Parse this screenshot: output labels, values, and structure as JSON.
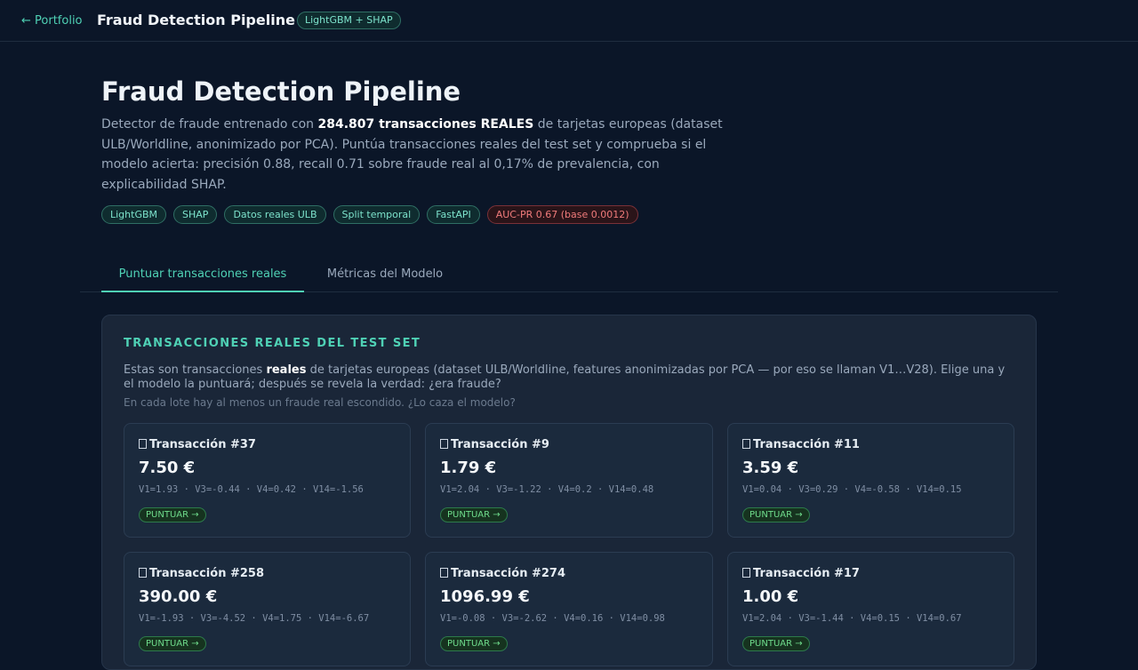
{
  "topbar": {
    "back_label": "← Portfolio",
    "title": "Fraud Detection Pipeline",
    "badge": "LightGBM + SHAP"
  },
  "hero": {
    "title": "Fraud Detection Pipeline",
    "desc_pre": "Detector de fraude entrenado con ",
    "desc_bold": "284.807 transacciones REALES",
    "desc_post": " de tarjetas europeas (dataset ULB/Worldline, anonimizado por PCA). Puntúa transacciones reales del test set y comprueba si el modelo acierta: precisión 0.88, recall 0.71 sobre fraude real al 0,17% de prevalencia, con explicabilidad SHAP."
  },
  "tags": [
    "LightGBM",
    "SHAP",
    "Datos reales ULB",
    "Split temporal",
    "FastAPI",
    "AUC-PR 0.67 (base 0.0012)"
  ],
  "tabs": [
    {
      "label": "Puntuar transacciones reales",
      "active": true
    },
    {
      "label": "Métricas del Modelo",
      "active": false
    }
  ],
  "panel": {
    "section_title": "TRANSACCIONES REALES DEL TEST SET",
    "intro_pre": "Estas son transacciones ",
    "intro_bold": "reales",
    "intro_post": " de tarjetas europeas (dataset ULB/Worldline, features anonimizadas por PCA — por eso se llaman V1…V28). Elige una y el modelo la puntuará; después se revela la verdad: ¿era fraude?",
    "hint": "En cada lote hay al menos un fraude real escondido. ¿Lo caza el modelo?"
  },
  "cards": [
    {
      "title": "Transacción #37",
      "amount": "7.50 €",
      "features": "V1=1.93 · V3=-0.44 · V4=0.42 · V14=-1.56",
      "button": "PUNTUAR →"
    },
    {
      "title": "Transacción #9",
      "amount": "1.79 €",
      "features": "V1=2.04 · V3=-1.22 · V4=0.2 · V14=0.48",
      "button": "PUNTUAR →"
    },
    {
      "title": "Transacción #11",
      "amount": "3.59 €",
      "features": "V1=0.04 · V3=0.29 · V4=-0.58 · V14=0.15",
      "button": "PUNTUAR →"
    },
    {
      "title": "Transacción #258",
      "amount": "390.00 €",
      "features": "V1=-1.93 · V3=-4.52 · V4=1.75 · V14=-6.67",
      "button": "PUNTUAR →"
    },
    {
      "title": "Transacción #274",
      "amount": "1096.99 €",
      "features": "V1=-0.08 · V3=-2.62 · V4=0.16 · V14=0.98",
      "button": "PUNTUAR →"
    },
    {
      "title": "Transacción #17",
      "amount": "1.00 €",
      "features": "V1=2.04 · V3=-1.44 · V4=0.15 · V14=0.67",
      "button": "PUNTUAR →"
    }
  ],
  "colors": {
    "background": "#0b1628",
    "accent": "#4fd1b5",
    "panel": "#1a2638",
    "danger": "#f07b7b",
    "success": "#6fdc8c"
  },
  "icons": {
    "card_icon": "card-icon"
  }
}
